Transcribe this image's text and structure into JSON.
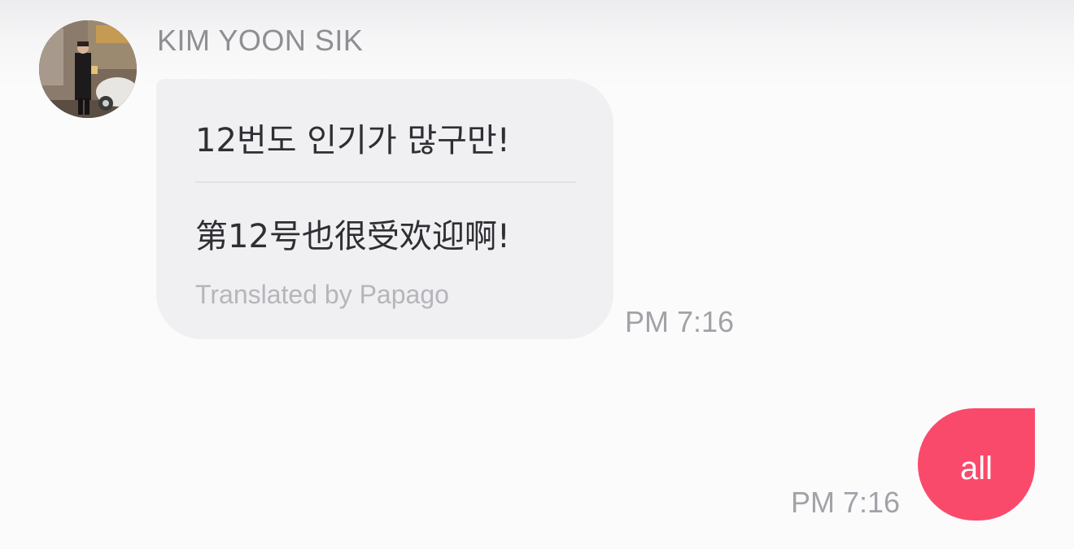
{
  "incoming": {
    "sender_name": "KIM YOON SIK",
    "avatar_icon": "profile-photo",
    "original_text": "12번도 인기가 많구만!",
    "translated_text": "第12号也很受欢迎啊!",
    "translation_credit": "Translated by Papago",
    "time": "PM 7:16",
    "bubble_color": "#f0f0f3"
  },
  "outgoing": {
    "text": "all",
    "time": "PM 7:16",
    "bubble_color": "#fa4a6b"
  }
}
